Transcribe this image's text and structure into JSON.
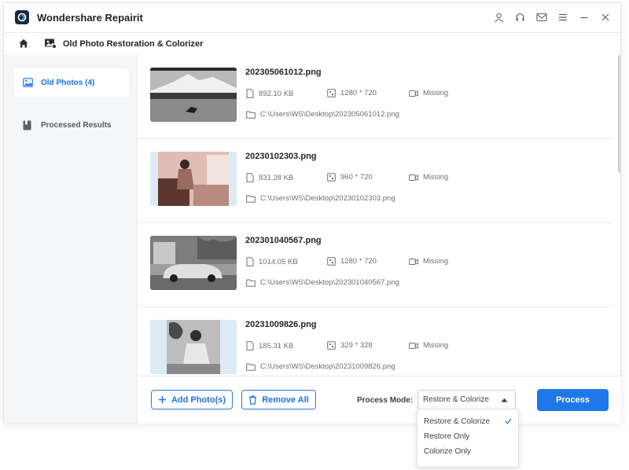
{
  "app": {
    "title": "Wondershare Repairit"
  },
  "titlebar": {
    "icons": [
      "user-icon",
      "headset-icon",
      "mail-icon",
      "menu-icon",
      "minimize-icon",
      "close-icon"
    ]
  },
  "breadcrumb": {
    "home_icon": "home-icon",
    "title": "Old Photo Restoration & Colorizer"
  },
  "sidebar": {
    "items": [
      {
        "label": "Old Photos (4)",
        "icon": "image-icon",
        "active": true
      },
      {
        "label": "Processed Results",
        "icon": "bookmark-icon",
        "active": false
      }
    ]
  },
  "files": [
    {
      "name": "202305061012.png",
      "size": "892.10  KB",
      "resolution": "1280 * 720",
      "video": "Missing",
      "path": "C:\\Users\\WS\\Desktop\\202305061012.png"
    },
    {
      "name": "20230102303.png",
      "size": "831.28  KB",
      "resolution": "960 * 720",
      "video": "Missing",
      "path": "C:\\Users\\WS\\Desktop\\20230102303.png"
    },
    {
      "name": "202301040567.png",
      "size": "1014.05  KB",
      "resolution": "1280 * 720",
      "video": "Missing",
      "path": "C:\\Users\\WS\\Desktop\\202301040567.png"
    },
    {
      "name": "20231009826.png",
      "size": "185.31  KB",
      "resolution": "329 * 328",
      "video": "Missing",
      "path": "C:\\Users\\WS\\Desktop\\20231009826.png"
    }
  ],
  "bottombar": {
    "add_label": "Add Photo(s)",
    "remove_label": "Remove All",
    "mode_label": "Process Mode:",
    "mode_value": "Restore & Colorize",
    "process_label": "Process"
  },
  "dropdown": {
    "options": [
      "Restore & Colorize",
      "Restore Only",
      "Colorize Only"
    ],
    "selected": "Restore & Colorize"
  },
  "colors": {
    "accent": "#1f78ea",
    "sidebar_bg": "#f5f6f8",
    "thumb_bg": "#dcebf3"
  }
}
